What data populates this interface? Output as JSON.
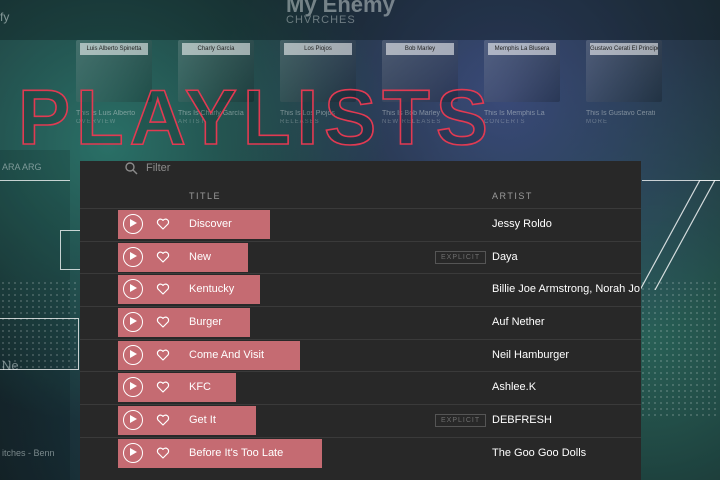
{
  "background": {
    "app_letters": "fy",
    "title": "My Enemy",
    "subtitle": "CHVRCHES",
    "thumbnails": [
      {
        "tag": "Luis Alberto Spinetta",
        "caption": "This Is Luis Alberto",
        "sub": "OVERVIEW"
      },
      {
        "tag": "Charly García",
        "caption": "This Is Charly García",
        "sub": "ARTIST"
      },
      {
        "tag": "Los Piojos",
        "caption": "This Is Los Piojos",
        "sub": "RELEASES"
      },
      {
        "tag": "Bob Marley",
        "caption": "This Is Bob Marley",
        "sub": "NEW RELEASES"
      },
      {
        "tag": "Memphis La Blusera",
        "caption": "This Is Memphis La",
        "sub": "CONCERTS"
      },
      {
        "tag": "Gustavo Cerati El Principe",
        "caption": "This Is Gustavo Cerati",
        "sub": "MORE"
      }
    ],
    "left_captions": [
      "ARA ARG",
      "Ne",
      "itches - Benn"
    ]
  },
  "headline": {
    "text": "PLAYLISTS",
    "color": "#e23a52"
  },
  "panel": {
    "filter_placeholder": "Filter",
    "columns": {
      "title": "TITLE",
      "artist": "ARTIST"
    },
    "explicit_label": "EXPLICIT",
    "highlight_color": "#c56b72",
    "tracks": [
      {
        "title": "Discover",
        "artist": "Jessy Roldo",
        "explicit": false,
        "highlight_end": 190
      },
      {
        "title": "New",
        "artist": "Daya",
        "explicit": true,
        "highlight_end": 168
      },
      {
        "title": "Kentucky",
        "artist": "Billie Joe Armstrong, Norah Jones",
        "explicit": false,
        "highlight_end": 180
      },
      {
        "title": "Burger",
        "artist": "Auf Nether",
        "explicit": false,
        "highlight_end": 170
      },
      {
        "title": "Come And Visit",
        "artist": "Neil Hamburger",
        "explicit": false,
        "highlight_end": 220
      },
      {
        "title": "KFC",
        "artist": "Ashlee.K",
        "explicit": false,
        "highlight_end": 156
      },
      {
        "title": "Get It",
        "artist": "DEBFRESH",
        "explicit": true,
        "highlight_end": 176
      },
      {
        "title": "Before It's Too Late",
        "artist": "The Goo Goo Dolls",
        "explicit": false,
        "highlight_end": 242
      }
    ]
  }
}
